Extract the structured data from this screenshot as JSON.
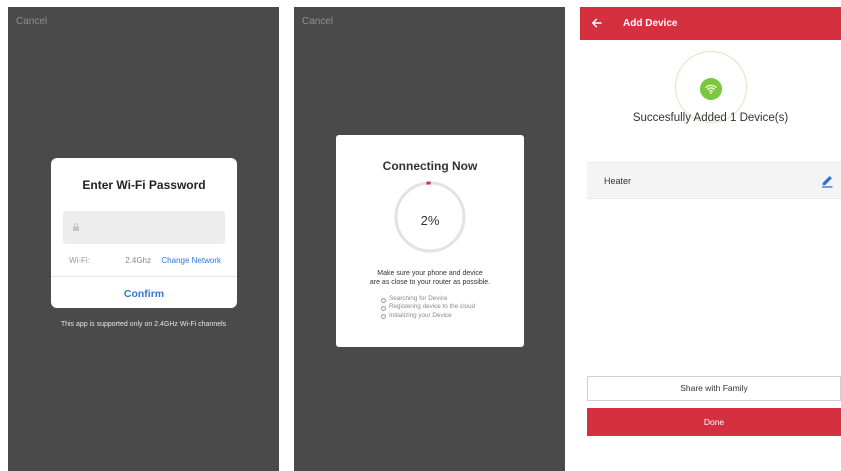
{
  "screen1": {
    "cancel_label": "Cancel",
    "dialog": {
      "title": "Enter Wi-Fi Password",
      "password_value": "",
      "wifi_label": "Wi-Fi:",
      "wifi_band": "2.4Ghz",
      "change_network_label": "Change Network",
      "confirm_label": "Confirm"
    },
    "support_note": "This app is supported only on 2.4GHz Wi-Fi channels"
  },
  "screen2": {
    "cancel_label": "Cancel",
    "dialog": {
      "title": "Connecting Now",
      "progress_percent_label": "2%",
      "progress_fraction": 0.02,
      "hint_line1": "Make sure your phone and device",
      "hint_line2": "are as close to your router as possible.",
      "steps": [
        "Searching for Device",
        "Registering device to the cloud",
        "Initializing your Device"
      ]
    }
  },
  "screen3": {
    "header": {
      "title": "Add Device"
    },
    "success_text": "Succesfully Added 1 Device(s)",
    "device": {
      "name": "Heater"
    },
    "share_label": "Share with Family",
    "done_label": "Done"
  },
  "colors": {
    "overlay_bg": "#4a4a4a",
    "accent_red": "#d5303f",
    "link_blue": "#2f7ad8",
    "wifi_green": "#7bc83e"
  }
}
